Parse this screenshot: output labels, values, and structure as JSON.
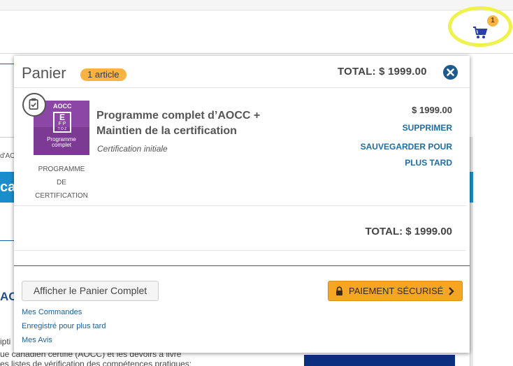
{
  "header": {
    "cart_icon": "shopping-cart-icon",
    "cart_count": "1"
  },
  "background": {
    "crumb_fragment": "d'AO",
    "banner_fragment": "ca",
    "heading_fragment": "AC",
    "text_lines": [
      "ipti",
      "ue canadien certifié (AOCC) et les devoirs à livre",
      "es listes de vérification des compétences pratiques:"
    ]
  },
  "cart": {
    "title": "Panier",
    "count_label": "1 article",
    "total_label": "TOTAL: $ 1999.00",
    "close_icon": "close-circle-icon",
    "item": {
      "thumbnail": {
        "brand": "AOCC",
        "chart_letters": [
          "E",
          "F P",
          "T O Z"
        ],
        "caption_line1": "Programme",
        "caption_line2": "complet"
      },
      "badge_icon": "clipboard-check-icon",
      "type_lines": [
        "PROGRAMME",
        "DE",
        "CERTIFICATION"
      ],
      "name": "Programme complet d’AOCC + Maintien de la certification",
      "subtitle": "Certification initiale",
      "price": "$ 1999.00",
      "remove_label": "SUPPRIMER",
      "save_label": "SAUVEGARDER POUR PLUS TARD"
    },
    "summary_total": "TOTAL: $ 1999.00",
    "view_full_label": "Afficher le Panier Complet",
    "checkout_label": "PAIEMENT SÉCURISÉ",
    "checkout_icons": [
      "lock-icon",
      "chevron-right-icon"
    ],
    "links": [
      "Mes Commandes",
      "Enregistré pour plus tard",
      "Mes Avis"
    ],
    "colors": {
      "accent": "#f6a623",
      "link": "#1d6da7",
      "badge": "#f7b443",
      "highlight": "#eef24a"
    }
  }
}
